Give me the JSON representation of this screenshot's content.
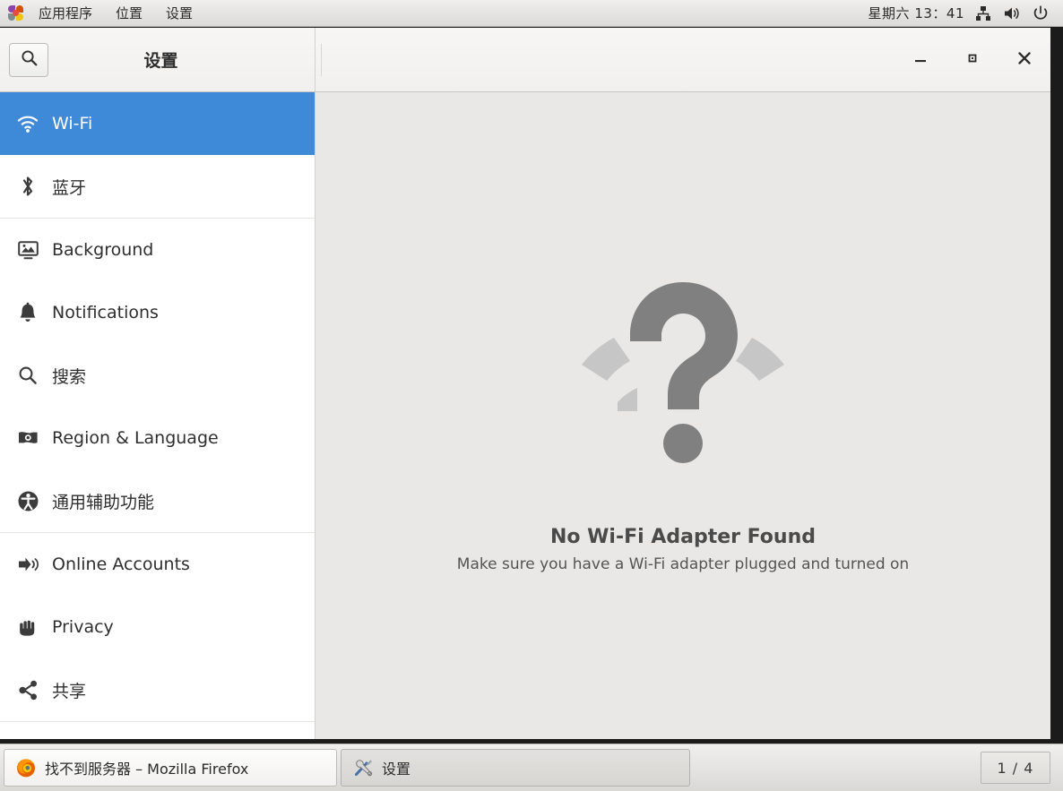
{
  "top_panel": {
    "logo_icon": "pinwheel-logo-icon",
    "menus": [
      {
        "label": "应用程序",
        "name": "applications"
      },
      {
        "label": "位置",
        "name": "places"
      },
      {
        "label": "设置",
        "name": "system"
      }
    ],
    "clock": "星期六  13：41",
    "tray": [
      {
        "name": "network-icon",
        "icon": "network-workgroup-icon"
      },
      {
        "name": "volume-icon",
        "icon": "audio-volume-icon"
      },
      {
        "name": "power-icon",
        "icon": "system-shutdown-icon"
      }
    ]
  },
  "window": {
    "title": "设置",
    "search_icon": "search-icon",
    "controls": {
      "minimize": "minimize-icon",
      "maximize": "maximize-icon",
      "close": "close-icon"
    }
  },
  "sidebar": {
    "items": [
      {
        "label": "Wi-Fi",
        "icon": "wifi-icon",
        "selected": true
      },
      {
        "label": "蓝牙",
        "icon": "bluetooth-icon",
        "selected": false
      },
      {
        "label": "Background",
        "icon": "monitor-icon",
        "selected": false
      },
      {
        "label": "Notifications",
        "icon": "bell-icon",
        "selected": false
      },
      {
        "label": "搜索",
        "icon": "search-icon",
        "selected": false
      },
      {
        "label": "Region & Language",
        "icon": "flag-icon",
        "selected": false
      },
      {
        "label": "通用辅助功能",
        "icon": "accessibility-icon",
        "selected": false
      },
      {
        "label": "Online Accounts",
        "icon": "online-accounts-icon",
        "selected": false
      },
      {
        "label": "Privacy",
        "icon": "hand-icon",
        "selected": false
      },
      {
        "label": "共享",
        "icon": "share-icon",
        "selected": false
      }
    ]
  },
  "content": {
    "icon": "no-wifi-adapter-question-mark-icon",
    "title": "No Wi-Fi Adapter Found",
    "subtitle": "Make sure you have a Wi-Fi adapter plugged and turned on"
  },
  "taskbar": {
    "tasks": [
      {
        "label": "找不到服务器 – Mozilla Firefox",
        "icon": "firefox-icon",
        "active": false
      },
      {
        "label": "设置",
        "icon": "tools-icon",
        "active": true
      }
    ],
    "workspace": "1 / 4"
  },
  "colors": {
    "accent": "#3f8ad8",
    "panel_bg": "#e4e3e1",
    "content_bg": "#e9e8e7",
    "sidebar_bg": "#ffffff",
    "icon_gray": "#808080",
    "icon_gray_light": "#c4c4c4"
  }
}
